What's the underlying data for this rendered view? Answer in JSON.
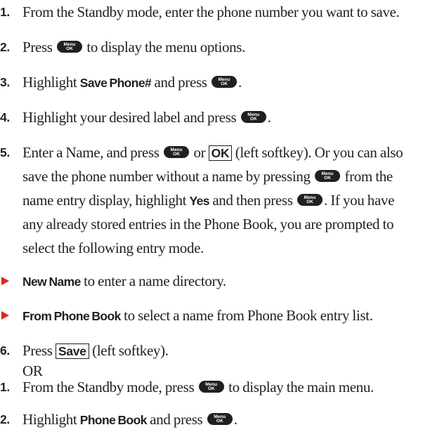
{
  "button_icon": {
    "line1": "Menu",
    "line2": "OK"
  },
  "steps": [
    {
      "num": "1.",
      "text": "From the Standby mode, enter the phone number you want to save."
    },
    {
      "num": "2.",
      "pre": "Press",
      "post": "to display the menu options."
    },
    {
      "num": "3.",
      "pre": "Highlight",
      "bold": "Save Phone#",
      "mid": "and press",
      "end": "."
    },
    {
      "num": "4.",
      "pre": "Highlight your desired label and press",
      "end": "."
    },
    {
      "num": "5.",
      "l1_pre": "Enter a Name, and press",
      "l1_or": "or",
      "l1_softkey": "OK",
      "l1_post": "(left softkey). Or you can also",
      "l2_pre": "save the phone number without a name by pressing",
      "l2_post": "from the",
      "l3_pre": "name entry display, highlight",
      "l3_bold": "Yes",
      "l3_mid": "and then press",
      "l3_post": ". If you have",
      "l4": "any already stored entries in the Phone Book, you are prompted to",
      "l5": "select the following entry mode."
    }
  ],
  "bullets": [
    {
      "bold": "New Name",
      "text": "to enter a name directory."
    },
    {
      "bold": "From Phone Book",
      "text": "to select a name from Phone Book entry list."
    }
  ],
  "step6": {
    "num": "6.",
    "pre": "Press",
    "softkey": "Save",
    "post": "(left softkey).",
    "or_text": "OR"
  },
  "alt_steps": [
    {
      "num": "1.",
      "pre": "From the Standby mode, press",
      "post": "to display the main menu."
    },
    {
      "num": "2.",
      "pre": "Highlight",
      "bold": "Phone Book",
      "mid": "and press",
      "end": "."
    }
  ],
  "colors": {
    "text": "#231f20",
    "bullet_arrow": "#e2231a",
    "background": "#ffffff"
  }
}
